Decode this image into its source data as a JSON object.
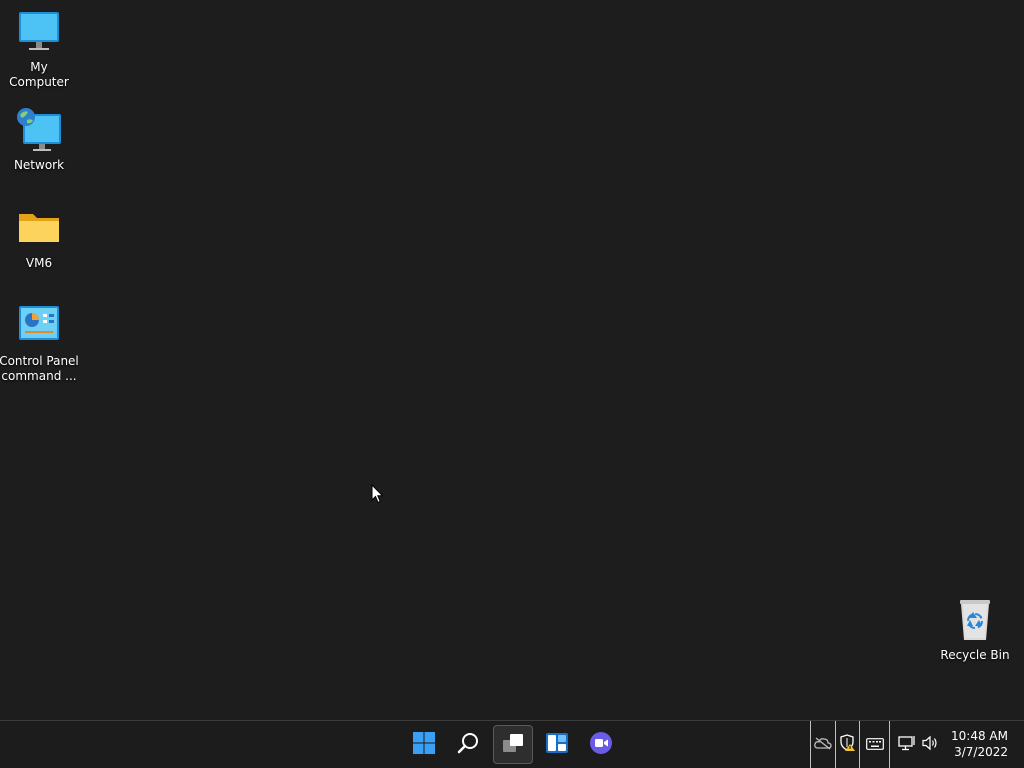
{
  "desktop": {
    "icons": [
      {
        "label": "My Computer",
        "icon": "monitor-icon"
      },
      {
        "label": "Network",
        "icon": "network-icon"
      },
      {
        "label": "VM6",
        "icon": "folder-icon"
      },
      {
        "label": "Control Panel command ...",
        "icon": "control-panel-icon"
      },
      {
        "label": "Recycle Bin",
        "icon": "recycle-bin-icon"
      }
    ]
  },
  "taskbar": {
    "pinned": [
      {
        "name": "Start",
        "icon": "windows-start-icon"
      },
      {
        "name": "Search",
        "icon": "search-icon"
      },
      {
        "name": "Task View",
        "icon": "task-view-icon",
        "active": true
      },
      {
        "name": "Widgets",
        "icon": "widgets-icon"
      },
      {
        "name": "Chat",
        "icon": "chat-icon"
      }
    ],
    "tray": {
      "icons": [
        "onedrive-offline-icon",
        "security-warning-icon",
        "keyboard-icon",
        "network-status-icon",
        "volume-icon"
      ],
      "time": "10:48 AM",
      "date": "3/7/2022"
    }
  },
  "colors": {
    "desktop_bg": "#1d1d1d",
    "taskbar_bg": "#1c1c1c",
    "accent": "#3aa0f3"
  }
}
